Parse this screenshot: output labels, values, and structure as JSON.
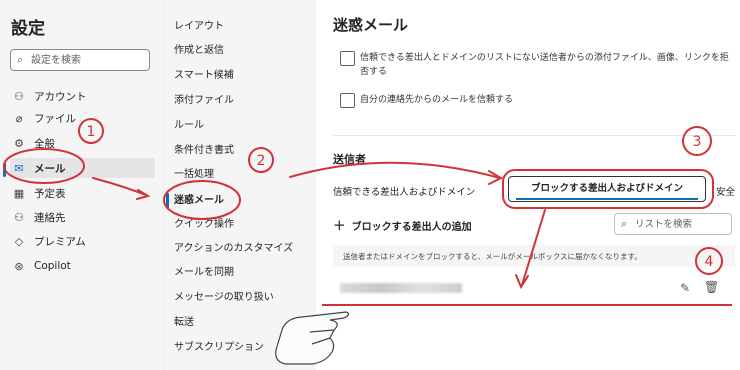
{
  "settings": {
    "title": "設定",
    "search_placeholder": "設定を検索",
    "categories": [
      {
        "icon": "person-icon",
        "label": "アカウント"
      },
      {
        "icon": "paperclip-icon",
        "label": "ファイル"
      },
      {
        "icon": "gear-icon",
        "label": "全般"
      },
      {
        "icon": "mail-icon",
        "label": "メール"
      },
      {
        "icon": "calendar-icon",
        "label": "予定表"
      },
      {
        "icon": "people-icon",
        "label": "連絡先"
      },
      {
        "icon": "diamond-icon",
        "label": "プレミアム"
      },
      {
        "icon": "copilot-icon",
        "label": "Copilot"
      }
    ]
  },
  "mail_menu": [
    "レイアウト",
    "作成と返信",
    "スマート候補",
    "添付ファイル",
    "ルール",
    "条件付き書式",
    "一括処理",
    "迷惑メール",
    "クイック操作",
    "アクションのカスタマイズ",
    "メールを同期",
    "メッセージの取り扱い",
    "転送",
    "サブスクリプション"
  ],
  "junk": {
    "title": "迷惑メール",
    "checkbox1": "信頼できる差出人とドメインのリストにない送信者からの添付ファイル、画像、リンクを拒",
    "checkbox1_cont": "否する",
    "checkbox2": "自分の連絡先からのメールを信頼する",
    "senders_heading": "送信者",
    "tab_trusted": "信頼できる差出人およびドメイン",
    "tab_blocked": "ブロックする差出人およびドメイン",
    "tab_safe_partial": "安全",
    "add_button": "ブロックする差出人の追加",
    "list_search_placeholder": "リストを検索",
    "info": "送信者またはドメインをブロックすると、メールがメールボックスに届かなくなります。"
  },
  "annotations": [
    "1",
    "2",
    "3",
    "4"
  ],
  "colors": {
    "accent": "#0f6cbd",
    "annotation": "#d13438"
  }
}
